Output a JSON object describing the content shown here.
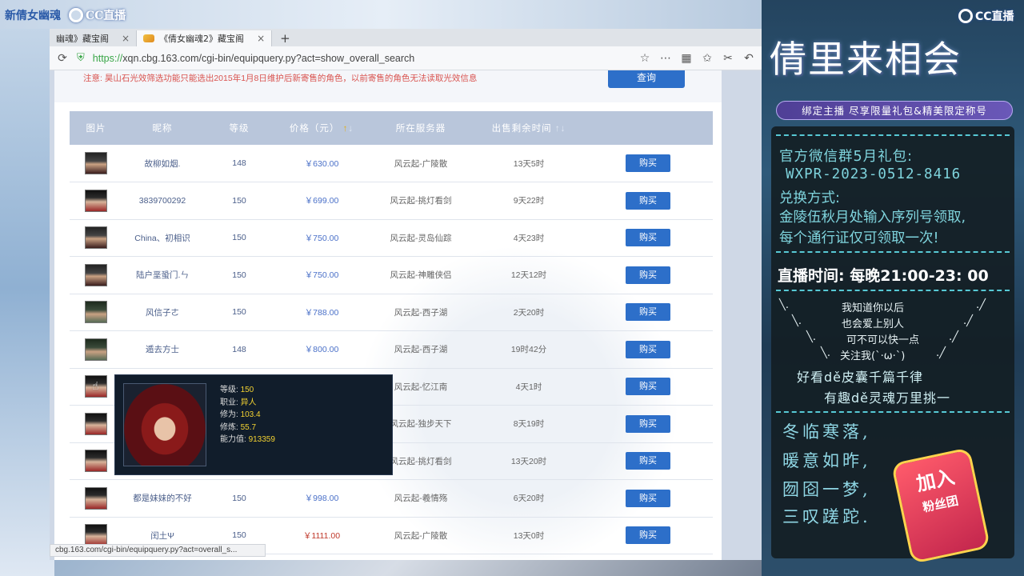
{
  "stream": {
    "top_left_game": "新倩女幽魂",
    "platform": "CC直播",
    "right_platform": "CC直播"
  },
  "browser": {
    "tabs": [
      {
        "label": "幽魂》藏宝阁",
        "close": "×"
      },
      {
        "label": "《倩女幽魂2》藏宝阁",
        "close": "×"
      }
    ],
    "new_tab": "+",
    "url_scheme": "https://",
    "url_rest": "xqn.cbg.163.com/cgi-bin/equipquery.py?act=show_overall_search",
    "status_url": "cbg.163.com/cgi-bin/equipquery.py?act=overall_s..."
  },
  "page": {
    "notice": "注意: 昊山石光效筛选功能只能选出2015年1月8日维护后新寄售的角色，以前寄售的角色无法读取光效信息",
    "query_button": "查询",
    "headers": [
      "图片",
      "昵称",
      "等级",
      "价格（元）",
      "所在服务器",
      "出售剩余时间"
    ],
    "rows": [
      {
        "name": "故柳如烟.",
        "level": "148",
        "price": "￥630.00",
        "server": "风云起-广陵散",
        "time": "13天5时",
        "buy": "购买",
        "avatar": "f"
      },
      {
        "name": "3839700292",
        "level": "150",
        "price": "￥699.00",
        "server": "风云起-挑灯看剑",
        "time": "9天22时",
        "buy": "购买",
        "avatar": "m1"
      },
      {
        "name": "China、初相识",
        "level": "150",
        "price": "￥750.00",
        "server": "风云起-灵岛仙踪",
        "time": "4天23时",
        "buy": "购买",
        "avatar": "f"
      },
      {
        "name": "陆户垩蛩门.ㄣ",
        "level": "150",
        "price": "￥750.00",
        "server": "风云起-神雕侠侣",
        "time": "12天12时",
        "buy": "购买",
        "avatar": "f"
      },
      {
        "name": "风信子ㄜ",
        "level": "150",
        "price": "￥788.00",
        "server": "风云起-西子湖",
        "time": "2天20时",
        "buy": "购买",
        "avatar": "m2"
      },
      {
        "name": "遁去方士",
        "level": "148",
        "price": "￥800.00",
        "server": "风云起-西子湖",
        "time": "19时42分",
        "buy": "购买",
        "avatar": "m2"
      },
      {
        "name": "",
        "level": "",
        "price": "",
        "server": "风云起-忆江南",
        "time": "4天1时",
        "buy": "购买",
        "avatar": "m1"
      },
      {
        "name": "",
        "level": "",
        "price": "",
        "server": "风云起-独步天下",
        "time": "8天19时",
        "buy": "购买",
        "avatar": "m1"
      },
      {
        "name": "",
        "level": "",
        "price": "",
        "server": "风云起-挑灯看剑",
        "time": "13天20时",
        "buy": "购买",
        "avatar": "m1"
      },
      {
        "name": "都是妹妹的不好",
        "level": "150",
        "price": "￥998.00",
        "server": "风云起-羲情殇",
        "time": "6天20时",
        "buy": "购买",
        "avatar": "m1"
      },
      {
        "name": "闰土Ψ",
        "level": "150",
        "price": "￥1111.00",
        "server": "风云起-广陵散",
        "time": "13天0时",
        "buy": "购买",
        "avatar": "m1",
        "price_red": true
      }
    ],
    "tooltip": {
      "level_label": "等级:",
      "level": "150",
      "class_label": "职业:",
      "class": "异人",
      "cultivation_label": "修为:",
      "cultivation": "103.4",
      "refine_label": "修炼:",
      "refine": "55.7",
      "power_label": "能力值:",
      "power": "913359"
    }
  },
  "panel": {
    "title": "倩里来相会",
    "subtitle": "绑定主播 尽享限量礼包&精美限定称号",
    "wechat_gift": "官方微信群5月礼包:",
    "code": "WXPR-2023-0512-8416",
    "redeem_title": "兑换方式:",
    "redeem_line1": "金陵伍秋月处输入序列号领取,",
    "redeem_line2": "每个通行证仅可领取一次!",
    "live_time": "直播时间: 每晚21:00-23: 00",
    "poem": [
      "我知道你以后",
      "也会爱上别人",
      "可不可以快一点",
      "关注我(`·ω·`)"
    ],
    "fun1": "好看dě皮囊千篇千律",
    "fun2": "有趣dě灵魂万里挑一",
    "verses": [
      "冬临寒落,",
      "暖意如昨,",
      "囫囵一梦,",
      "三叹蹉跎."
    ],
    "badge_top": "加入",
    "badge_bottom": "粉丝团"
  },
  "colors": {
    "accent_blue": "#2d6fc9",
    "header_bg": "#b9c6db",
    "panel_text": "#7fd4dd",
    "notice_red": "#d9534f",
    "tooltip_value": "#f3d232"
  }
}
